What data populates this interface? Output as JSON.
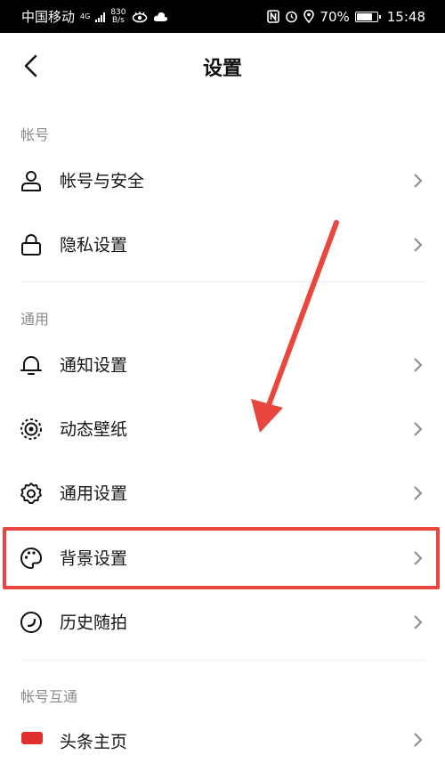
{
  "status_bar": {
    "carrier": "中国移动",
    "network": "4G",
    "net_speed_value": "830",
    "net_speed_unit": "B/s",
    "battery": "70%",
    "time": "15:48"
  },
  "nav": {
    "title": "设置"
  },
  "sections": [
    {
      "label": "帐号",
      "items": [
        {
          "label": "帐号与安全",
          "icon": "user-icon"
        },
        {
          "label": "隐私设置",
          "icon": "lock-icon"
        }
      ]
    },
    {
      "label": "通用",
      "items": [
        {
          "label": "通知设置",
          "icon": "bell-icon"
        },
        {
          "label": "动态壁纸",
          "icon": "live-wallpaper-icon"
        },
        {
          "label": "通用设置",
          "icon": "gear-icon"
        },
        {
          "label": "背景设置",
          "icon": "palette-icon"
        },
        {
          "label": "历史随拍",
          "icon": "history-icon"
        }
      ]
    },
    {
      "label": "帐号互通",
      "items": [
        {
          "label": "头条主页",
          "icon": "toutiao-icon"
        }
      ]
    }
  ],
  "colors": {
    "annotation": "#e8463e",
    "section_label": "#8a8a8a",
    "divider": "#ececec"
  }
}
